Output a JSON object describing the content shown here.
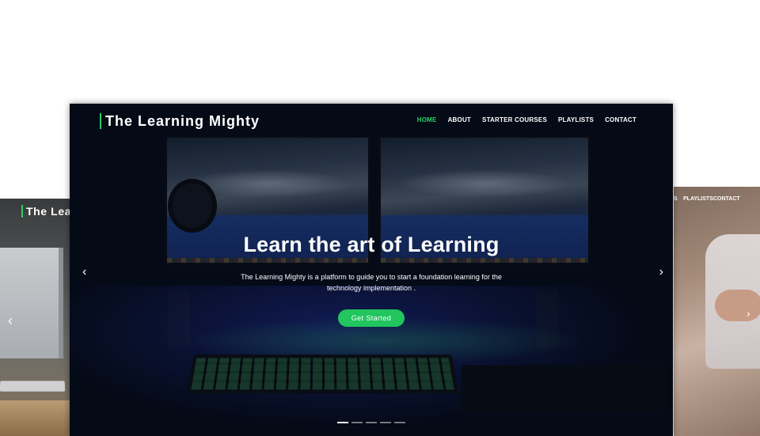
{
  "left_card": {
    "brand": "The Lea",
    "prev_icon": "‹"
  },
  "right_card": {
    "nav": [
      "S",
      "PLAYLISTS",
      "CONTACT"
    ],
    "next_icon": "›"
  },
  "main": {
    "brand": "The Learning Mighty",
    "nav": [
      {
        "label": "HOME",
        "active": true
      },
      {
        "label": "ABOUT",
        "active": false
      },
      {
        "label": "STARTER COURSES",
        "active": false
      },
      {
        "label": "PLAYLISTS",
        "active": false
      },
      {
        "label": "CONTACT",
        "active": false
      }
    ],
    "hero_title": "Learn the art of Learning",
    "hero_subtitle": "The Learning Mighty is a platform to guide you to start a foundation learning for the technology implementation .",
    "cta_label": "Get Started",
    "prev_icon": "‹",
    "next_icon": "›",
    "slide_count": 5,
    "active_slide": 1
  },
  "colors": {
    "accent": "#27d163",
    "button": "#22c55e",
    "text": "#ffffff"
  },
  "icons": [
    "chevron-left-icon",
    "chevron-right-icon"
  ]
}
